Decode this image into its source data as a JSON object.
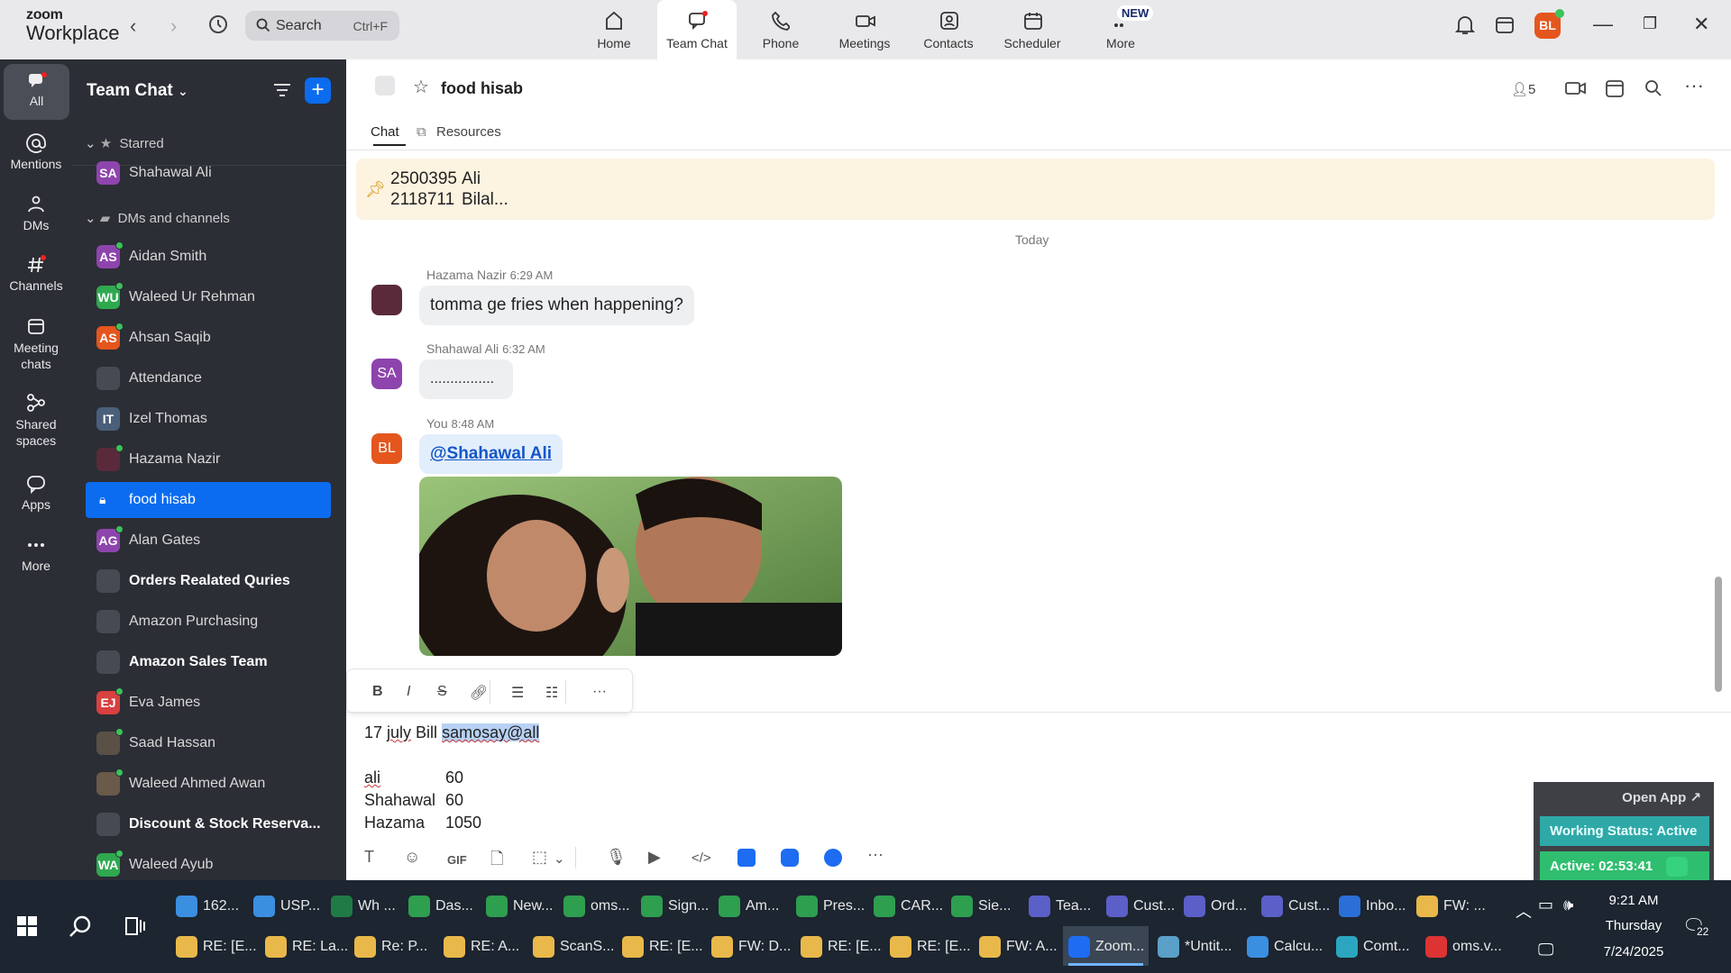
{
  "app": {
    "brand_top": "zoom",
    "brand_bottom": "Workplace"
  },
  "search": {
    "label": "Search",
    "shortcut": "Ctrl+F"
  },
  "top_tabs": [
    {
      "label": "Home",
      "icon": "home-icon"
    },
    {
      "label": "Team Chat",
      "icon": "chat-icon"
    },
    {
      "label": "Phone",
      "icon": "phone-icon"
    },
    {
      "label": "Meetings",
      "icon": "video-icon"
    },
    {
      "label": "Contacts",
      "icon": "contacts-icon"
    },
    {
      "label": "Scheduler",
      "icon": "calendar-icon"
    },
    {
      "label": "More",
      "icon": "more-icon"
    }
  ],
  "new_badge": "NEW",
  "user_avatar": "BL",
  "rail": [
    {
      "label": "All"
    },
    {
      "label": "Mentions"
    },
    {
      "label": "DMs"
    },
    {
      "label": "Channels"
    },
    {
      "label": "Meeting chats"
    },
    {
      "label": "Shared spaces"
    },
    {
      "label": "Apps"
    },
    {
      "label": "More"
    }
  ],
  "sidebar": {
    "title": "Team Chat",
    "sections": {
      "starred": "Starred",
      "dms": "DMs and channels"
    },
    "items": [
      {
        "name": "Shahawal Ali",
        "initials": "SA",
        "color": "#8e44ad"
      },
      {
        "name": "Aidan Smith",
        "initials": "AS",
        "color": "#8e44ad"
      },
      {
        "name": "Waleed Ur Rehman",
        "initials": "WU",
        "color": "#2fa84f"
      },
      {
        "name": "Ahsan Saqib",
        "initials": "AS",
        "color": "#e4561e"
      },
      {
        "name": "Attendance",
        "initials": "",
        "color": ""
      },
      {
        "name": "Izel Thomas",
        "initials": "IT",
        "color": "#4a5f7a"
      },
      {
        "name": "Hazama Nazir",
        "initials": "",
        "color": "#5a2a3a"
      },
      {
        "name": "food hisab",
        "initials": "",
        "color": ""
      },
      {
        "name": "Alan Gates",
        "initials": "AG",
        "color": "#8e44ad"
      },
      {
        "name": "Orders Realated Quries",
        "initials": "",
        "color": ""
      },
      {
        "name": "Amazon Purchasing",
        "initials": "",
        "color": ""
      },
      {
        "name": "Amazon Sales Team",
        "initials": "",
        "color": ""
      },
      {
        "name": "Eva James",
        "initials": "EJ",
        "color": "#d94040"
      },
      {
        "name": "Saad Hassan",
        "initials": "",
        "color": "#5a5045"
      },
      {
        "name": "Waleed Ahmed Awan",
        "initials": "",
        "color": "#6a5a4a"
      },
      {
        "name": "Discount & Stock Reserva...",
        "initials": "",
        "color": ""
      },
      {
        "name": "Waleed Ayub",
        "initials": "WA",
        "color": "#2fa84f"
      }
    ]
  },
  "channel": {
    "name": "food hisab",
    "member_count": "5",
    "tabs": [
      "Chat",
      "Resources"
    ]
  },
  "pinned": {
    "line1_id": "2500395",
    "line1_name": "Ali",
    "line2_id": "2118711",
    "line2_name": "Bilal..."
  },
  "day_divider": "Today",
  "messages": [
    {
      "sender": "Hazama Nazir",
      "time": "6:29 AM",
      "text": "tomma ge fries when happening?",
      "initials": ""
    },
    {
      "sender": "Shahawal Ali",
      "time": "6:32 AM",
      "text": "................",
      "initials": "SA"
    },
    {
      "sender": "You",
      "time": "8:48 AM",
      "text": "@Shahawal Ali",
      "initials": "BL"
    }
  ],
  "composer": {
    "line1_plain": "17 ",
    "line1_july": "july",
    "line1_mid": " Bill ",
    "line1_sel": "samosay@all",
    "rows": [
      {
        "name": "ali",
        "value": "60"
      },
      {
        "name": "Shahawal",
        "value": "60"
      },
      {
        "name": "Hazama",
        "value": "1050"
      }
    ],
    "toolbar_gif": "GIF"
  },
  "overlay": {
    "open": "Open App ↗",
    "status": "Working Status: Active",
    "active": "Active: 02:53:41"
  },
  "taskbar": {
    "row1": [
      "162...",
      "USP...",
      "Wh ...",
      "Das...",
      "New...",
      "oms...",
      "Sign...",
      "Am...",
      "Pres...",
      "CAR...",
      "Sie...",
      "Tea...",
      "Cust...",
      "Ord...",
      "Cust...",
      "Inbo...",
      "FW: ..."
    ],
    "row2": [
      "RE: [E...",
      "RE: La...",
      "Re: P...",
      "RE: A...",
      "ScanS...",
      "RE: [E...",
      "FW: D...",
      "RE: [E...",
      "RE: [E...",
      "FW: A...",
      "Zoom...",
      "*Untit...",
      "Calcu...",
      "Comt...",
      "oms.v..."
    ],
    "time": "9:21 AM",
    "day": "Thursday",
    "date": "7/24/2025",
    "notifications": "22",
    "colors": {
      "app_blue": "#3b8fe0",
      "chrome": "#2e9e4f",
      "teams": "#5b5fc7",
      "excel": "#1f7a45",
      "outlook": "#2a6fd8",
      "mail": "#e9b84a",
      "zoom": "#1d6cf2",
      "pdf": "#d33"
    }
  }
}
